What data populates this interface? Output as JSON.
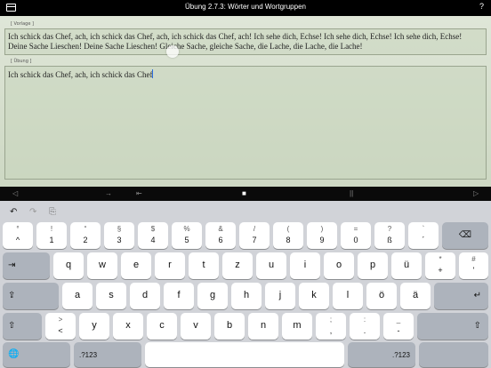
{
  "topbar": {
    "title": "Übung 2.7.3: Wörter und Wortgruppen",
    "help_icon": "?",
    "left_icon": "window-icon"
  },
  "vorlage": {
    "label": "[ Vorlage ]",
    "text": "Ich schick das Chef, ach, ich schick das Chef, ach, ich schick das Chef, ach! Ich sehe dich, Echse! Ich sehe dich, Echse! Ich sehe dich, Echse! Deine Sache Lieschen! Deine Sache Lieschen! Gleiche Sache, gleiche Sache, die Lache, die Lache, die Lache!"
  },
  "uebung": {
    "label": "[ Übung ]",
    "text": "Ich schick das Chef, ach, ich schick das Chef"
  },
  "navbar": {
    "items": [
      "◁",
      "→",
      "⇤",
      "■",
      "||",
      "▷"
    ]
  },
  "kbtop": {
    "undo": "↶",
    "redo": "↷",
    "paste": "⎘"
  },
  "keyboard": {
    "row1": [
      {
        "top": "°",
        "bot": "^"
      },
      {
        "top": "!",
        "bot": "1"
      },
      {
        "top": "“",
        "bot": "2"
      },
      {
        "top": "§",
        "bot": "3"
      },
      {
        "top": "$",
        "bot": "4"
      },
      {
        "top": "%",
        "bot": "5"
      },
      {
        "top": "&",
        "bot": "6"
      },
      {
        "top": "/",
        "bot": "7"
      },
      {
        "top": "(",
        "bot": "8"
      },
      {
        "top": ")",
        "bot": "9"
      },
      {
        "top": "=",
        "bot": "0"
      },
      {
        "top": "?",
        "bot": "ß"
      },
      {
        "top": "`",
        "bot": "´"
      }
    ],
    "delete": "⌫",
    "tab": "⇥",
    "row2": [
      "q",
      "w",
      "e",
      "r",
      "t",
      "z",
      "u",
      "i",
      "o",
      "p",
      "ü"
    ],
    "row2_last": {
      "top": "*",
      "bot": "+"
    },
    "row2_extra": {
      "top": "#",
      "bot": "'"
    },
    "caps": "⇪",
    "row3": [
      "a",
      "s",
      "d",
      "f",
      "g",
      "h",
      "j",
      "k",
      "l",
      "ö",
      "ä"
    ],
    "return": "↵",
    "shift": "⇧",
    "row4_first": {
      "top": ">",
      "bot": "<"
    },
    "row4": [
      "y",
      "x",
      "c",
      "v",
      "b",
      "n",
      "m"
    ],
    "row4_punct": [
      {
        "top": ";",
        "bot": ","
      },
      {
        "top": ":",
        "bot": "."
      },
      {
        "top": "_",
        "bot": "-"
      }
    ],
    "globe": "🌐",
    "numbers": ".?123"
  }
}
